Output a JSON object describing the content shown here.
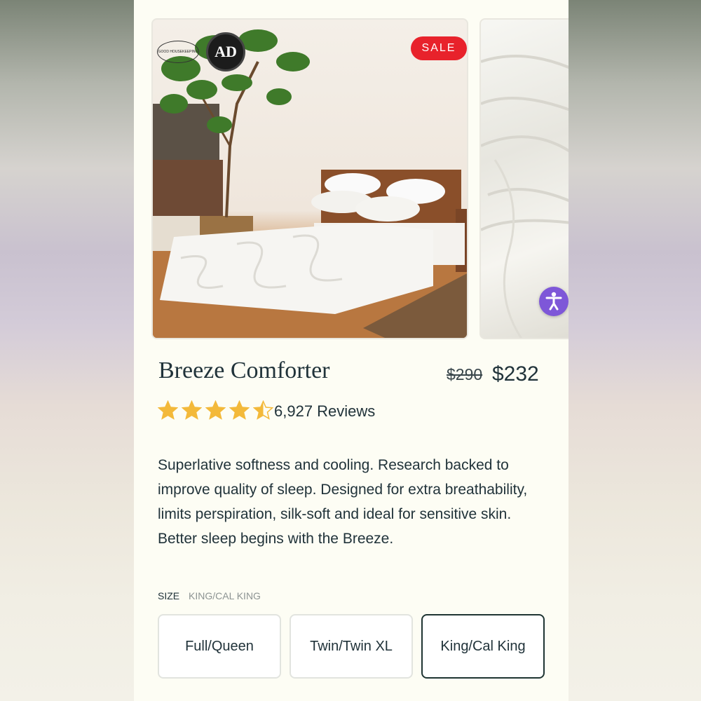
{
  "gallery": {
    "badge": "SALE",
    "award_text": "AD",
    "gh_text": "GOOD HOUSEKEEPING"
  },
  "product": {
    "title": "Breeze Comforter",
    "original_price": "$290",
    "sale_price": "$232",
    "rating": 4.5,
    "rating_max": 5,
    "reviews": "6,927 Reviews",
    "description": "Superlative softness and cooling. Research backed to improve quality of sleep. Designed for extra breathability, limits perspiration, silk-soft and ideal for sensitive skin. Better sleep begins with the Breeze."
  },
  "size": {
    "label": "SIZE",
    "selected_value": "KING/CAL KING",
    "options": [
      "Full/Queen",
      "Twin/Twin XL",
      "King/Cal King"
    ],
    "selected_index": 2
  },
  "colors": {
    "accent_text": "#21333a",
    "sale_red": "#e8222b",
    "star_gold": "#f3b93a",
    "accessibility_purple": "#7e57d8"
  },
  "icons": {
    "accessibility": "accessibility-icon",
    "star": "star-icon"
  }
}
